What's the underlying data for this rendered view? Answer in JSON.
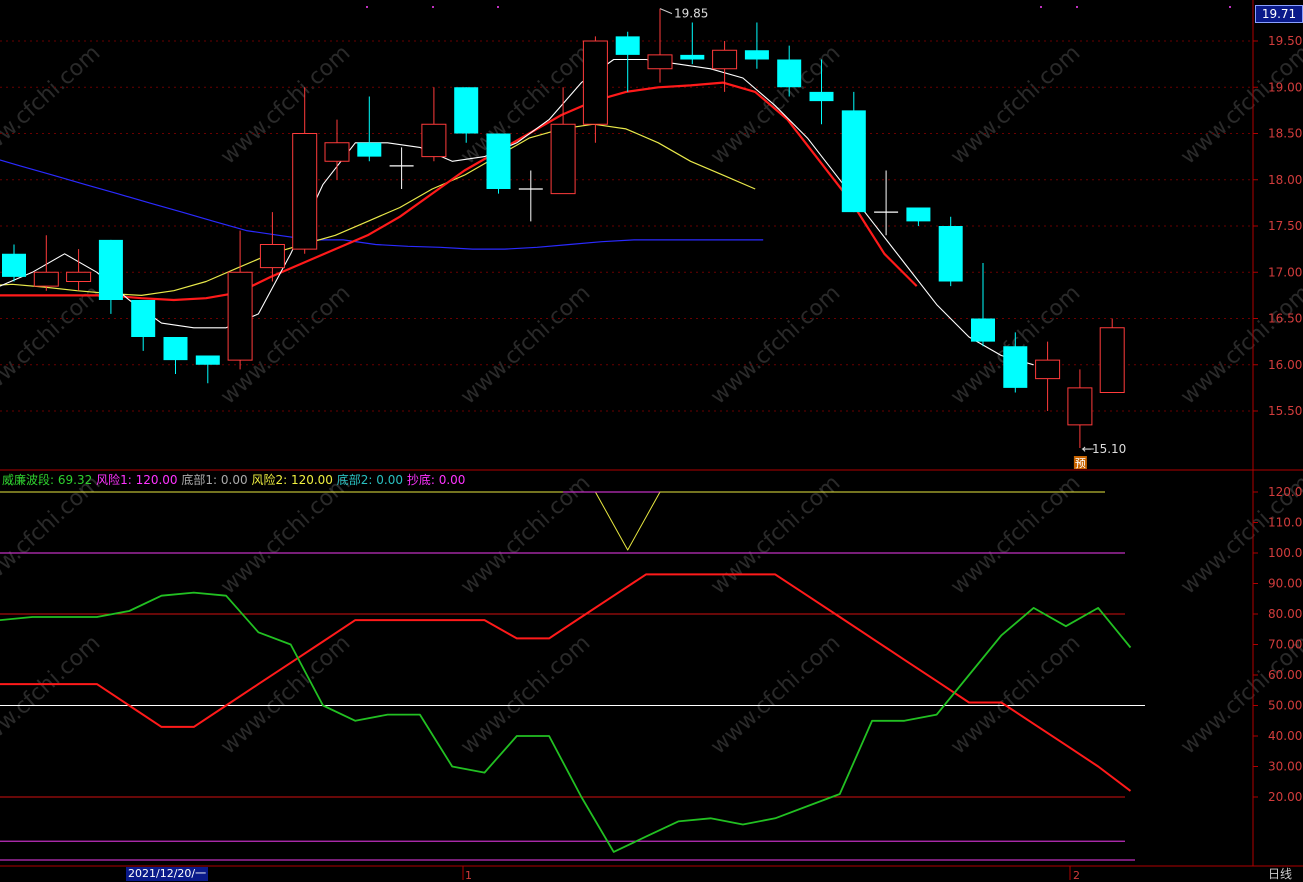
{
  "header": {
    "last_price": "19.71"
  },
  "main_chart": {
    "ylim": [
      15.0,
      19.9
    ],
    "yticks": [
      "19.50",
      "19.00",
      "18.50",
      "18.00",
      "17.50",
      "17.00",
      "16.50",
      "16.00",
      "15.50"
    ],
    "high_label": "19.85",
    "low_label": "15.10",
    "predict_badge": "预",
    "colors": {
      "up": "#ff3b3b",
      "down": "#00ffff",
      "doji": "#ffffff",
      "ma_white": "#ffffff",
      "ma_red": "#ff1a1a",
      "ma_yellow": "#e8e84a",
      "ma_blue": "#2a2aff"
    }
  },
  "chart_data": [
    {
      "type": "candlestick",
      "ylim": [
        15.0,
        19.9
      ],
      "candles": [
        {
          "o": 17.2,
          "h": 17.3,
          "l": 16.9,
          "c": 16.95
        },
        {
          "o": 16.85,
          "h": 17.4,
          "l": 16.8,
          "c": 17.0
        },
        {
          "o": 16.9,
          "h": 17.25,
          "l": 16.8,
          "c": 17.0
        },
        {
          "o": 17.35,
          "h": 17.35,
          "l": 16.55,
          "c": 16.7
        },
        {
          "o": 16.7,
          "h": 16.7,
          "l": 16.15,
          "c": 16.3
        },
        {
          "o": 16.3,
          "h": 16.3,
          "l": 15.9,
          "c": 16.05
        },
        {
          "o": 16.1,
          "h": 16.1,
          "l": 15.8,
          "c": 16.0
        },
        {
          "o": 16.05,
          "h": 17.45,
          "l": 15.95,
          "c": 17.0
        },
        {
          "o": 17.05,
          "h": 17.65,
          "l": 16.9,
          "c": 17.3
        },
        {
          "o": 17.25,
          "h": 19.0,
          "l": 17.2,
          "c": 18.5
        },
        {
          "o": 18.2,
          "h": 18.65,
          "l": 18.0,
          "c": 18.4
        },
        {
          "o": 18.4,
          "h": 18.9,
          "l": 18.2,
          "c": 18.25
        },
        {
          "o": 18.15,
          "h": 18.35,
          "l": 17.9,
          "c": 18.15
        },
        {
          "o": 18.25,
          "h": 19.0,
          "l": 18.2,
          "c": 18.6
        },
        {
          "o": 19.0,
          "h": 19.0,
          "l": 18.4,
          "c": 18.5
        },
        {
          "o": 18.5,
          "h": 18.5,
          "l": 17.85,
          "c": 17.9
        },
        {
          "o": 17.9,
          "h": 18.1,
          "l": 17.55,
          "c": 17.9
        },
        {
          "o": 17.85,
          "h": 19.0,
          "l": 17.85,
          "c": 18.6
        },
        {
          "o": 18.6,
          "h": 19.55,
          "l": 18.4,
          "c": 19.5
        },
        {
          "o": 19.55,
          "h": 19.6,
          "l": 18.95,
          "c": 19.35
        },
        {
          "o": 19.2,
          "h": 19.85,
          "l": 19.05,
          "c": 19.35
        },
        {
          "o": 19.35,
          "h": 19.7,
          "l": 19.25,
          "c": 19.3
        },
        {
          "o": 19.2,
          "h": 19.5,
          "l": 18.95,
          "c": 19.4
        },
        {
          "o": 19.4,
          "h": 19.7,
          "l": 19.2,
          "c": 19.3
        },
        {
          "o": 19.3,
          "h": 19.45,
          "l": 18.9,
          "c": 19.0
        },
        {
          "o": 18.95,
          "h": 19.3,
          "l": 18.6,
          "c": 18.85
        },
        {
          "o": 18.75,
          "h": 18.95,
          "l": 17.65,
          "c": 17.65
        },
        {
          "o": 17.65,
          "h": 18.1,
          "l": 17.4,
          "c": 17.65
        },
        {
          "o": 17.7,
          "h": 17.7,
          "l": 17.5,
          "c": 17.55
        },
        {
          "o": 17.5,
          "h": 17.6,
          "l": 16.85,
          "c": 16.9
        },
        {
          "o": 16.5,
          "h": 17.1,
          "l": 16.2,
          "c": 16.25
        },
        {
          "o": 16.2,
          "h": 16.35,
          "l": 15.7,
          "c": 15.75
        },
        {
          "o": 15.85,
          "h": 16.25,
          "l": 15.5,
          "c": 16.05
        },
        {
          "o": 15.35,
          "h": 15.95,
          "l": 15.1,
          "c": 15.75
        },
        {
          "o": 15.7,
          "h": 16.5,
          "l": 15.7,
          "c": 16.4
        }
      ],
      "ma_white": [
        16.85,
        17.0,
        17.2,
        17.0,
        16.7,
        16.45,
        16.4,
        16.4,
        16.55,
        17.2,
        17.95,
        18.4,
        18.4,
        18.35,
        18.2,
        18.25,
        18.4,
        18.65,
        19.05,
        19.3,
        19.3,
        19.25,
        19.2,
        19.1,
        18.8,
        18.45,
        18.0,
        17.55,
        17.1,
        16.65,
        16.3,
        16.1,
        16.0
      ],
      "ma_red": [
        16.75,
        16.75,
        16.75,
        16.75,
        16.75,
        16.72,
        16.7,
        16.72,
        16.78,
        16.95,
        17.1,
        17.25,
        17.4,
        17.6,
        17.85,
        18.1,
        18.3,
        18.5,
        18.7,
        18.85,
        18.95,
        19.0,
        19.02,
        19.05,
        18.95,
        18.65,
        18.2,
        17.75,
        17.2,
        16.85
      ],
      "ma_yellow": [
        16.85,
        16.87,
        16.84,
        16.8,
        16.77,
        16.75,
        16.8,
        16.9,
        17.05,
        17.2,
        17.3,
        17.4,
        17.55,
        17.7,
        17.9,
        18.05,
        18.25,
        18.45,
        18.55,
        18.6,
        18.55,
        18.4,
        18.2,
        18.05,
        17.9
      ],
      "ma_blue": [
        18.25,
        18.15,
        18.05,
        17.95,
        17.85,
        17.75,
        17.65,
        17.55,
        17.45,
        17.4,
        17.35,
        17.35,
        17.3,
        17.28,
        17.27,
        17.25,
        17.25,
        17.27,
        17.3,
        17.33,
        17.35,
        17.35,
        17.35,
        17.35,
        17.35
      ]
    },
    {
      "type": "line",
      "ylim": [
        0,
        125
      ],
      "yticks": [
        "120.0",
        "110.0",
        "100.0",
        "90.00",
        "80.00",
        "70.00",
        "60.00",
        "50.00",
        "40.00",
        "30.00",
        "20.00"
      ],
      "indicator_values": [
        {
          "name": "威廉波段",
          "value": "69.32",
          "color": "#2fd22f"
        },
        {
          "name": "风险1",
          "value": "120.00",
          "color": "#ff33ff"
        },
        {
          "name": "底部1",
          "value": "0.00",
          "color": "#aaaaaa"
        },
        {
          "name": "风险2",
          "value": "120.00",
          "color": "#f0f040"
        },
        {
          "name": "底部2",
          "value": "0.00",
          "color": "#2ac0c0"
        },
        {
          "name": "抄底",
          "value": "0.00",
          "color": "#ff33ff"
        }
      ],
      "green_series": [
        78,
        79,
        79,
        79,
        81,
        86,
        87,
        86,
        74,
        70,
        50,
        45,
        47,
        47,
        30,
        28,
        40,
        40,
        20,
        2,
        7,
        12,
        13,
        11,
        13,
        17,
        21,
        45,
        45,
        47,
        60,
        73,
        82,
        76,
        82,
        69
      ],
      "red_series": [
        57,
        57,
        57,
        57,
        50,
        43,
        43,
        50,
        57,
        64,
        71,
        78,
        78,
        78,
        78,
        78,
        72,
        72,
        79,
        86,
        93,
        93,
        93,
        93,
        93,
        86,
        79,
        72,
        65,
        58,
        51,
        51,
        44,
        37,
        30,
        22
      ],
      "yellow_series": [
        120,
        120,
        120,
        120,
        120,
        120,
        120,
        120,
        120,
        120,
        120,
        120,
        120,
        120,
        120,
        120,
        120,
        120,
        120,
        101,
        120,
        120,
        120,
        120,
        120,
        120,
        120,
        120,
        120,
        120,
        120,
        120,
        120,
        120,
        120,
        120
      ],
      "ref_lines": {
        "purple": [
          100,
          5.5
        ],
        "red": [
          80,
          20
        ],
        "white": [
          50
        ]
      }
    }
  ],
  "xaxis": {
    "date_label": "2021/12/20/一",
    "tick_1": "1",
    "tick_2": "2"
  },
  "footer": {
    "period_label": "日线"
  },
  "watermark": "www.cfchi.com"
}
